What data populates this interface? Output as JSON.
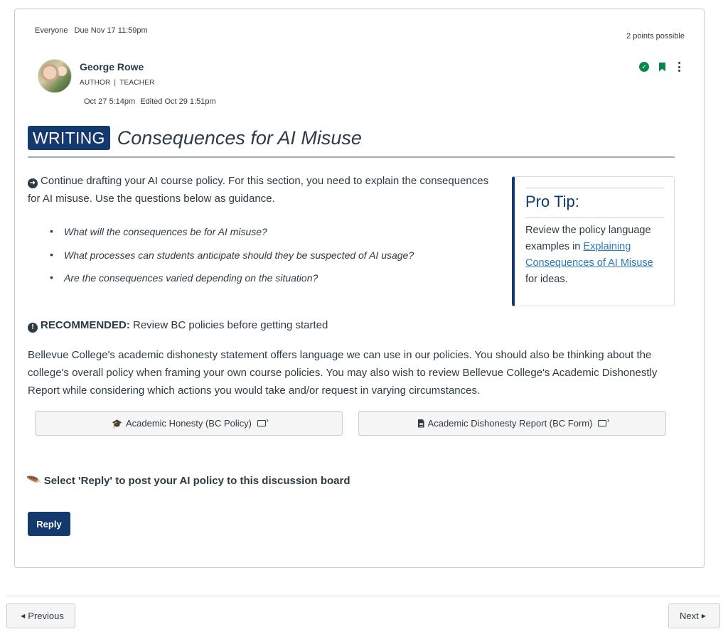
{
  "header": {
    "audience": "Everyone",
    "due": "Due Nov 17 11:59pm",
    "points": "2 points possible"
  },
  "author": {
    "name": "George Rowe",
    "role_primary": "AUTHOR",
    "role_separator": "|",
    "role_secondary": "TEACHER",
    "posted": "Oct 27 5:14pm",
    "edited": "Edited Oct 29 1:51pm",
    "avatar_icon": "user-photo"
  },
  "actions": {
    "published_icon": "check-circle-icon",
    "bookmark_icon": "bookmark-icon",
    "menu_icon": "kebab-menu-icon",
    "status_color": "#0b874b"
  },
  "content": {
    "badge": "WRITING",
    "title": "Consequences for AI Misuse",
    "intro": "Continue drafting your AI course policy. For this section, you need to explain the consequences for AI misuse. Use the questions below as guidance.",
    "questions": [
      "What will the consequences be for AI misuse?",
      "What processes can students anticipate should they be suspected of AI usage?",
      "Are the consequences varied depending on the situation?"
    ],
    "protip": {
      "title": "Pro Tip:",
      "body_before": "Review the policy language examples in ",
      "link": "Explaining Consequences of AI Misuse",
      "body_after": " for ideas."
    },
    "recommended_label": "RECOMMENDED:",
    "recommended_text": " Review BC policies before getting started",
    "paragraph": "Bellevue College's academic dishonesty statement offers language we can use in our policies. You should also be thinking about the college's overall policy when framing your own course policies. You may also wish to review Bellevue College's Academic Dishonestly Report while considering which actions you would take and/or request in varying circumstances.",
    "link_buttons": [
      {
        "label": "Academic Honesty (BC Policy)",
        "icon": "graduation-cap-icon"
      },
      {
        "label": "Academic Dishonesty Report (BC Form)",
        "icon": "document-icon"
      }
    ],
    "reply_prompt": "Select 'Reply' to post your AI policy to this discussion board",
    "reply_button": "Reply"
  },
  "colors": {
    "brand": "#13396e",
    "link": "#2b7abc",
    "text": "#2d3b45"
  },
  "footer": {
    "previous": "Previous",
    "next": "Next"
  }
}
